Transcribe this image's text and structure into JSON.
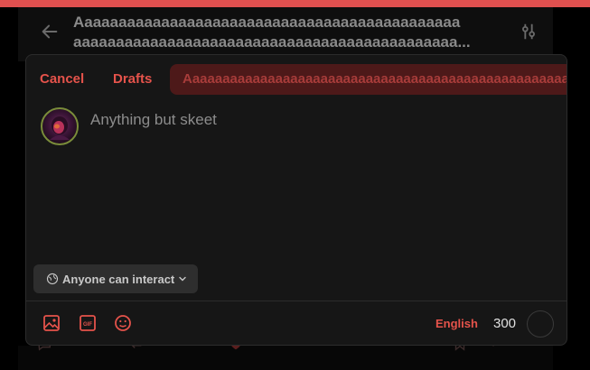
{
  "colors": {
    "accent": "#e5534b",
    "post_bg": "#4d1919",
    "modal_bg": "#161616"
  },
  "background_header": {
    "title_line1": "Aaaaaaaaaaaaaaaaaaaaaaaaaaaaaaaaaaaaaaaaaaaaa",
    "title_line2": "aaaaaaaaaaaaaaaaaaaaaaaaaaaaaaaaaaaaaaaaaaaaa...",
    "back_icon": "arrow-left-icon",
    "filter_icon": "sliders-icon"
  },
  "composer": {
    "cancel_label": "Cancel",
    "drafts_label": "Drafts",
    "post_button_label": "Aaaaaaaaaaaaaaaaaaaaaaaaaaaaaaaaaaaaaaaaaaaaaaaaaaaaaa",
    "placeholder": "Anything but skeet",
    "interaction_setting": "Anyone can interact",
    "toolbar": {
      "image_icon": "image-icon",
      "gif_label": "GIF",
      "emoji_icon": "emoji-icon"
    },
    "language": "English",
    "char_count": "300"
  }
}
